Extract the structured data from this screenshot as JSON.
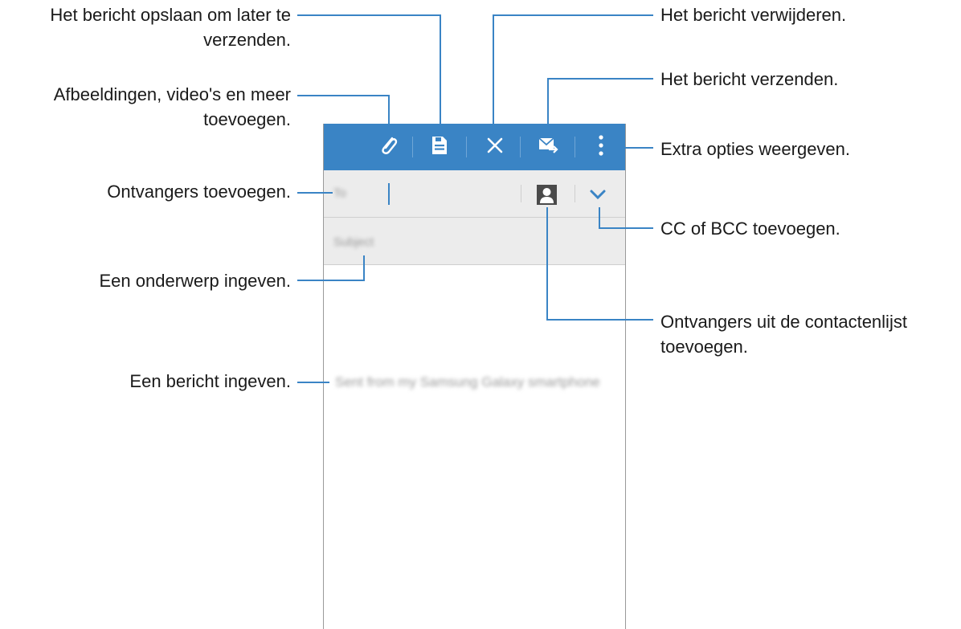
{
  "compose": {
    "to_placeholder": "To",
    "subject_placeholder": "Subject",
    "body_text": "Sent from my Samsung Galaxy smartphone"
  },
  "labels": {
    "save_line1": "Het bericht opslaan om later te",
    "save_line2": "verzenden.",
    "attach_line1": "Afbeeldingen, video's en meer",
    "attach_line2": "toevoegen.",
    "recipients": "Ontvangers toevoegen.",
    "subject": "Een onderwerp ingeven.",
    "body": "Een bericht ingeven.",
    "delete": "Het bericht verwijderen.",
    "send": "Het bericht verzenden.",
    "more": "Extra opties weergeven.",
    "cc_bcc": "CC of BCC toevoegen.",
    "contacts_line1": "Ontvangers uit de contactenlijst",
    "contacts_line2": "toevoegen."
  },
  "icons": {
    "attach": "paperclip-icon",
    "save": "save-draft-icon",
    "delete": "close-icon",
    "send": "send-mail-icon",
    "more": "more-options-icon",
    "contacts": "contact-icon",
    "cc_bcc": "chevron-down-icon"
  },
  "colors": {
    "accent": "#3a84c5",
    "field_bg": "#ececec",
    "text": "#1a1a1a"
  }
}
